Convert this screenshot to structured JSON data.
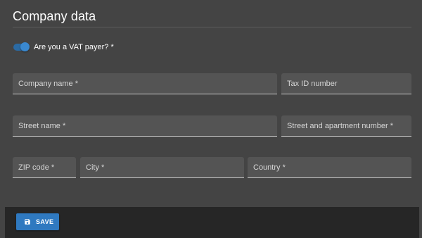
{
  "page": {
    "title": "Company data"
  },
  "vat": {
    "label": "Are you a VAT payer? *",
    "checked": true
  },
  "fields": {
    "company_name": {
      "label": "Company name *"
    },
    "tax_id": {
      "label": "Tax ID number"
    },
    "street_name": {
      "label": "Street name *"
    },
    "street_number": {
      "label": "Street and apartment number *"
    },
    "zip_code": {
      "label": "ZIP code *"
    },
    "city": {
      "label": "City *"
    },
    "country": {
      "label": "Country *"
    }
  },
  "footer": {
    "save_label": "SAVE",
    "save_icon": "floppy-disk-icon"
  },
  "colors": {
    "background": "#444444",
    "field_background": "#545454",
    "footer_background": "#262626",
    "accent": "#2f79c0"
  }
}
